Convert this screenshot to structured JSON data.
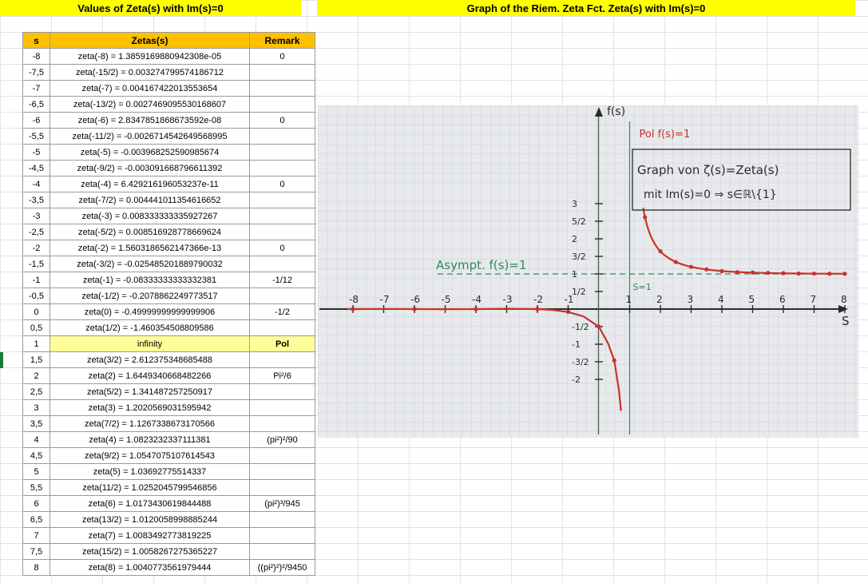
{
  "banners": {
    "left": "Values of Zeta(s) with Im(s)=0",
    "right": "Graph of the Riem. Zeta Fct. Zeta(s) with Im(s)=0"
  },
  "table": {
    "headers": [
      "s",
      "Zetas(s)",
      "Remark"
    ],
    "rows": [
      {
        "s": "-8",
        "zeta": "zeta(-8) = 1.3859169880942308e-05",
        "remark": "0"
      },
      {
        "s": "-7,5",
        "zeta": "zeta(-15/2) = 0.003274799574186712",
        "remark": ""
      },
      {
        "s": "-7",
        "zeta": "zeta(-7) = 0.004167422013553654",
        "remark": ""
      },
      {
        "s": "-6,5",
        "zeta": "zeta(-13/2) = 0.0027469095530168607",
        "remark": ""
      },
      {
        "s": "-6",
        "zeta": "zeta(-6) = 2.8347851868673592e-08",
        "remark": "0"
      },
      {
        "s": "-5,5",
        "zeta": "zeta(-11/2) = -0.0026714542649568995",
        "remark": ""
      },
      {
        "s": "-5",
        "zeta": "zeta(-5) = -0.003968252590985674",
        "remark": ""
      },
      {
        "s": "-4,5",
        "zeta": "zeta(-9/2) = -0.003091668796611392",
        "remark": ""
      },
      {
        "s": "-4",
        "zeta": "zeta(-4) = 6.429216196053237e-11",
        "remark": "0"
      },
      {
        "s": "-3,5",
        "zeta": "zeta(-7/2) = 0.004441011354616652",
        "remark": ""
      },
      {
        "s": "-3",
        "zeta": "zeta(-3) = 0.008333333335927267",
        "remark": ""
      },
      {
        "s": "-2,5",
        "zeta": "zeta(-5/2) = 0.008516928778669624",
        "remark": ""
      },
      {
        "s": "-2",
        "zeta": "zeta(-2) = 1.5603186562147366e-13",
        "remark": "0"
      },
      {
        "s": "-1,5",
        "zeta": "zeta(-3/2) = -0.025485201889790032",
        "remark": ""
      },
      {
        "s": "-1",
        "zeta": "zeta(-1) = -0.08333333333332381",
        "remark": "-1/12"
      },
      {
        "s": "-0,5",
        "zeta": "zeta(-1/2) = -0.2078862249773517",
        "remark": ""
      },
      {
        "s": "0",
        "zeta": "zeta(0) = -0.49999999999999906",
        "remark": "-1/2"
      },
      {
        "s": "0,5",
        "zeta": "zeta(1/2) = -1.460354508809586",
        "remark": ""
      },
      {
        "s": "1",
        "zeta": "infinity",
        "remark": "Pol",
        "pole": true
      },
      {
        "s": "1,5",
        "zeta": "zeta(3/2) = 2.612375348685488",
        "remark": ""
      },
      {
        "s": "2",
        "zeta": "zeta(2) = 1.6449340668482266",
        "remark": "Pi²/6"
      },
      {
        "s": "2,5",
        "zeta": "zeta(5/2) = 1.341487257250917",
        "remark": ""
      },
      {
        "s": "3",
        "zeta": "zeta(3) = 1.2020569031595942",
        "remark": ""
      },
      {
        "s": "3,5",
        "zeta": "zeta(7/2) = 1.1267338673170566",
        "remark": ""
      },
      {
        "s": "4",
        "zeta": "zeta(4) = 1.0823232337111381",
        "remark": "(pi²)²/90"
      },
      {
        "s": "4,5",
        "zeta": "zeta(9/2) = 1.0547075107614543",
        "remark": ""
      },
      {
        "s": "5",
        "zeta": "zeta(5) = 1.03692775514337",
        "remark": ""
      },
      {
        "s": "5,5",
        "zeta": "zeta(11/2) = 1.0252045799546856",
        "remark": ""
      },
      {
        "s": "6",
        "zeta": "zeta(6) = 1.0173430619844488",
        "remark": "(pi²)³/945"
      },
      {
        "s": "6,5",
        "zeta": "zeta(13/2) = 1.0120058998885244",
        "remark": ""
      },
      {
        "s": "7",
        "zeta": "zeta(7) = 1.0083492773819225",
        "remark": ""
      },
      {
        "s": "7,5",
        "zeta": "zeta(15/2) = 1.0058267275365227",
        "remark": ""
      },
      {
        "s": "8",
        "zeta": "zeta(8) = 1.0040773561979444",
        "remark": "((pi²)²)²/9450"
      }
    ]
  },
  "graph": {
    "y_axis_label": "f(s)",
    "x_axis_label": "S",
    "pole_label": "Pol f(s)=1",
    "asymptote_label": "Asympt. f(s)=1",
    "pole_marker": "S=1",
    "legend_line1": "Graph von ζ(s)=Zeta(s)",
    "legend_line2": "mit Im(s)=0 ⇒ s∈ℝ\\{1}",
    "x_ticks": [
      "-8",
      "-7",
      "-6",
      "-5",
      "-4",
      "-3",
      "-2",
      "-1",
      "1",
      "2",
      "3",
      "4",
      "5",
      "6",
      "7",
      "8"
    ],
    "y_ticks": [
      "3",
      "5/2",
      "2",
      "3/2",
      "1",
      "1/2",
      "-1/2",
      "-1",
      "-3/2",
      "-2"
    ],
    "colors": {
      "curve": "#c8322a",
      "asymptote": "#2e8b57",
      "ink": "#2b2b2b",
      "paper": "#e7e9ec"
    }
  }
}
